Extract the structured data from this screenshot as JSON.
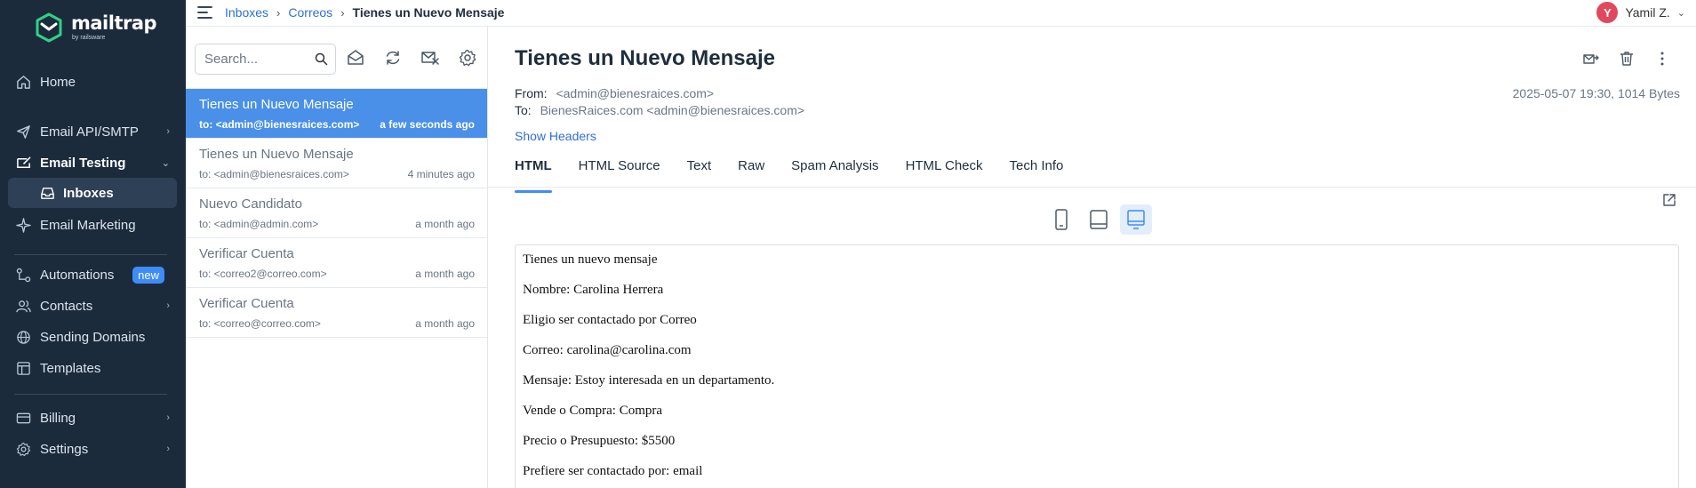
{
  "app": {
    "logo_text": "mailtrap",
    "logo_sub": "by railsware",
    "brand_color": "#1c2b3c",
    "accent_color": "#3f8cf7"
  },
  "sidebar": {
    "items": [
      {
        "label": "Home",
        "icon": "home-icon"
      },
      {
        "label": "Email API/SMTP",
        "icon": "send-icon",
        "chevron": "›"
      },
      {
        "label": "Email Testing",
        "icon": "inbox-test-icon",
        "chevron": "⌄"
      },
      {
        "label": "Inboxes",
        "icon": "inbox-icon"
      },
      {
        "label": "Email Marketing",
        "icon": "marketing-icon"
      },
      {
        "label": "Automations",
        "icon": "automation-icon",
        "badge": "new"
      },
      {
        "label": "Contacts",
        "icon": "contacts-icon",
        "chevron": "›"
      },
      {
        "label": "Sending Domains",
        "icon": "globe-icon"
      },
      {
        "label": "Templates",
        "icon": "template-icon"
      },
      {
        "label": "Billing",
        "icon": "billing-icon",
        "chevron": "›"
      },
      {
        "label": "Settings",
        "icon": "gear-icon",
        "chevron": "›"
      }
    ]
  },
  "topbar": {
    "breadcrumbs": [
      "Inboxes",
      "Correos",
      "Tienes un Nuevo Mensaje"
    ],
    "separator": "›",
    "user_initial": "Y",
    "user_name": "Yamil Z.",
    "user_chevron": "⌄"
  },
  "list": {
    "search_placeholder": "Search...",
    "messages": [
      {
        "subject": "Tienes un Nuevo Mensaje",
        "to": "to: <admin@bienesraices.com>",
        "when": "a few seconds ago"
      },
      {
        "subject": "Tienes un Nuevo Mensaje",
        "to": "to: <admin@bienesraices.com>",
        "when": "4 minutes ago"
      },
      {
        "subject": "Nuevo Candidato",
        "to": "to: <admin@admin.com>",
        "when": "a month ago"
      },
      {
        "subject": "Verificar Cuenta",
        "to": "to: <correo2@correo.com>",
        "when": "a month ago"
      },
      {
        "subject": "Verificar Cuenta",
        "to": "to: <correo@correo.com>",
        "when": "a month ago"
      }
    ]
  },
  "detail": {
    "title": "Tienes un Nuevo Mensaje",
    "from_label": "From:",
    "from_value": "<admin@bienesraices.com>",
    "to_label": "To:",
    "to_value": "BienesRaices.com <admin@bienesraices.com>",
    "date_size": "2025-05-07 19:30, 1014 Bytes",
    "show_headers": "Show Headers",
    "tabs": [
      "HTML",
      "HTML Source",
      "Text",
      "Raw",
      "Spam Analysis",
      "HTML Check",
      "Tech Info"
    ],
    "body_lines": [
      "Tienes un nuevo mensaje",
      "Nombre: Carolina Herrera",
      "Eligio ser contactado por Correo",
      "Correo: carolina@carolina.com",
      "Mensaje: Estoy interesada en un departamento.",
      "Vende o Compra: Compra",
      "Precio o Presupuesto: $5500",
      "Prefiere ser contactado por: email"
    ]
  }
}
